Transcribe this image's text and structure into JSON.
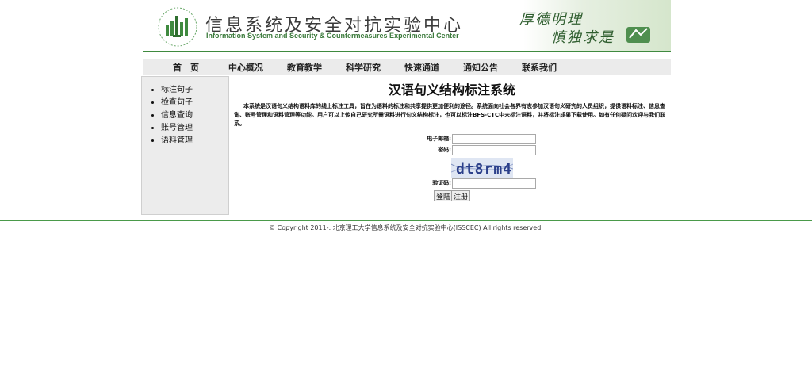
{
  "header": {
    "title_cn": "信息系统及安全对抗实验中心",
    "title_en": "Information System and Security & Countermeasures Experimental Center",
    "motto_line1": "厚德明理",
    "motto_line2": "慎独求是"
  },
  "nav": {
    "items": [
      "首　页",
      "中心概况",
      "教育教学",
      "科学研究",
      "快速通道",
      "通知公告",
      "联系我们"
    ]
  },
  "sidebar": {
    "items": [
      "标注句子",
      "检查句子",
      "信息查询",
      "账号管理",
      "语料管理"
    ]
  },
  "main": {
    "title": "汉语句义结构标注系统",
    "intro": "本系统是汉语句义结构语料库的线上标注工具，旨在为语料的标注和共享提供更加便利的途径。系统面向社会各界有志参加汉语句义研究的人员组织，提供语料标注、信息查询、账号管理和语料管理等功能。用户可以上传自己研究所需语料进行句义结构标注，也可以标注BFS-CTC中未标注语料，并将标注成果下载使用。如有任何疑问欢迎与我们联系。"
  },
  "login": {
    "email_label": "电子邮箱:",
    "email_value": "",
    "password_label": "密码:",
    "password_value": "",
    "captcha_text": "dt8rm4",
    "captcha_label": "验证码:",
    "captcha_value": "",
    "login_button": "登陆",
    "register_button": "注册"
  },
  "footer": {
    "copyright": "© Copyright 2011-. 北京理工大学信息系统及安全对抗实验中心(ISSCEC) All rights reserved."
  },
  "colors": {
    "accent_green": "#3f8a3f",
    "nav_bg": "#ebebeb",
    "sidebar_bg": "#ececec"
  }
}
